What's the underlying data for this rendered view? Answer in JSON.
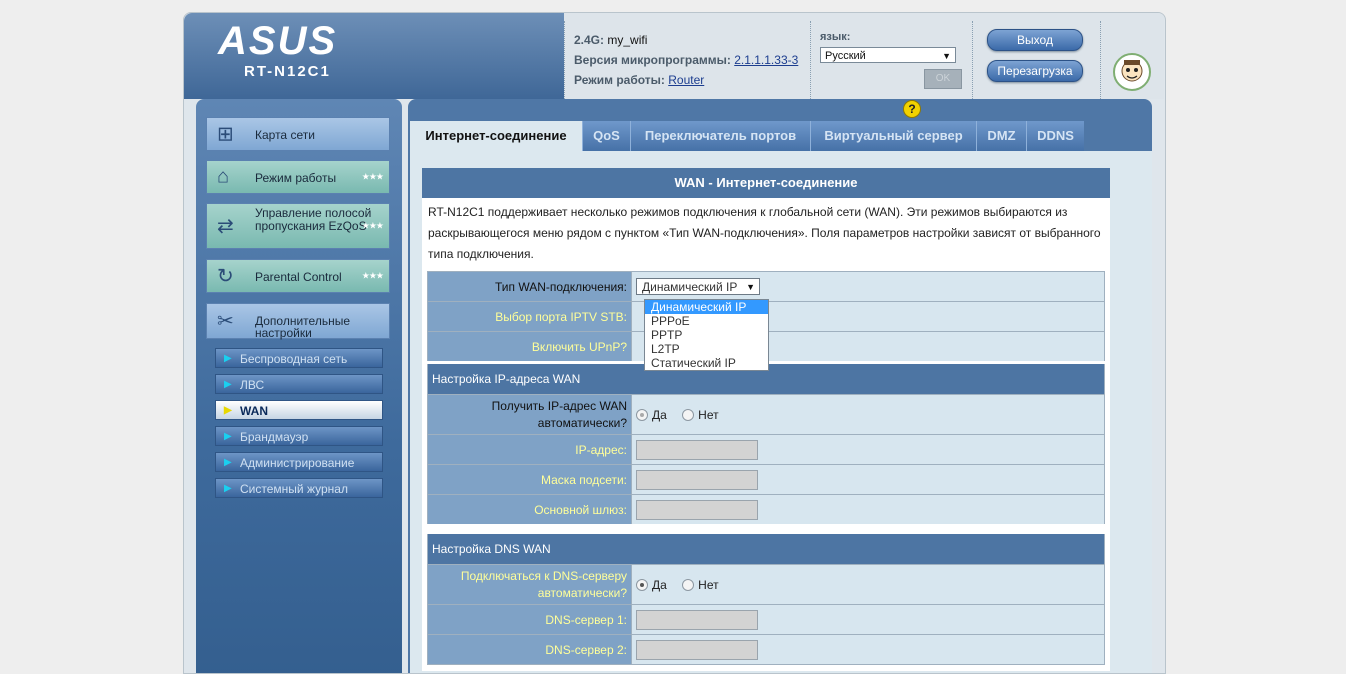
{
  "header": {
    "logo": "ASUS",
    "model": "RT-N12C1",
    "ssid_label": "2.4G:",
    "ssid_value": "my_wifi",
    "fw_label": "Версия микропрограммы:",
    "fw_value": "2.1.1.1.33-3",
    "mode_label": "Режим работы:",
    "mode_value": "Router",
    "lang_label": "язык:",
    "lang_value": "Русский",
    "ok_label": "OK",
    "logout_label": "Выход",
    "reboot_label": "Перезагрузка"
  },
  "nav": {
    "main": [
      {
        "label": "Карта сети",
        "icon": "network-map-icon"
      },
      {
        "label": "Режим работы",
        "icon": "router-icon"
      },
      {
        "label": "Управление полосой пропускания EzQoS",
        "icon": "qos-icon"
      },
      {
        "label": "Parental Control",
        "icon": "parental-control-icon"
      },
      {
        "label": "Дополнительные настройки",
        "icon": "tools-icon"
      }
    ],
    "sub": [
      {
        "label": "Беспроводная сеть",
        "active": false
      },
      {
        "label": "ЛВС",
        "active": false
      },
      {
        "label": "WAN",
        "active": true
      },
      {
        "label": "Брандмауэр",
        "active": false
      },
      {
        "label": "Администрирование",
        "active": false
      },
      {
        "label": "Системный журнал",
        "active": false
      }
    ]
  },
  "tabs": [
    {
      "label": "Интернет-соединение",
      "active": true
    },
    {
      "label": "QoS",
      "active": false
    },
    {
      "label": "Переключатель портов",
      "active": false
    },
    {
      "label": "Виртуальный сервер",
      "active": false
    },
    {
      "label": "DMZ",
      "active": false
    },
    {
      "label": "DDNS",
      "active": false
    }
  ],
  "form": {
    "title": "WAN - Интернет-соединение",
    "description": "RT-N12C1 поддерживает несколько режимов подключения к глобальной сети (WAN). Эти режимов выбираются из раскрывающегося меню рядом с пунктом «Тип WAN-подключения». Поля параметров настройки зависят от выбранного типа подключения.",
    "wan_type_label": "Тип WAN-подключения:",
    "wan_type_value": "Динамический IP",
    "wan_type_options": [
      "Динамический IP",
      "PPPoE",
      "PPTP",
      "L2TP",
      "Статический IP"
    ],
    "iptv_label": "Выбор порта IPTV STB:",
    "upnp_label": "Включить UPnP?",
    "ip_section": "Настройка IP-адреса WAN",
    "auto_ip_label": "Получить IP-адрес WAN автоматически?",
    "yes": "Да",
    "no": "Нет",
    "ip_label": "IP-адрес:",
    "mask_label": "Маска подсети:",
    "gateway_label": "Основной шлюз:",
    "dns_section": "Настройка DNS WAN",
    "auto_dns_label": "Подключаться к DNS-серверу автоматически?",
    "dns1_label": "DNS-сервер 1:",
    "dns2_label": "DNS-сервер 2:"
  }
}
